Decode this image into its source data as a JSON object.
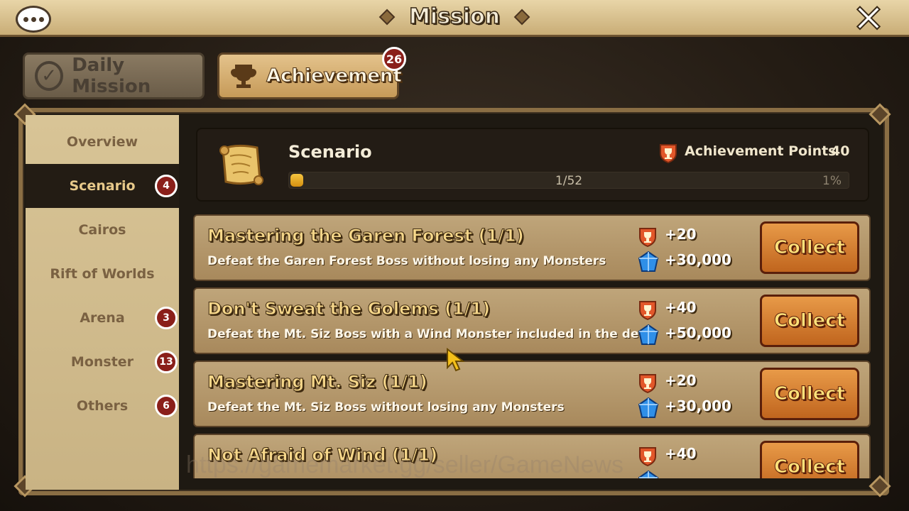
{
  "window": {
    "title": "Mission",
    "chat_icon": "chat-bubble-icon",
    "close_icon": "close-icon"
  },
  "tabs": [
    {
      "label": "Daily Mission",
      "icon": "checkmark-icon",
      "active": false
    },
    {
      "label": "Achievement",
      "icon": "trophy-icon",
      "active": true,
      "badge": "26"
    }
  ],
  "sidebar": {
    "items": [
      {
        "label": "Overview",
        "badge": ""
      },
      {
        "label": "Scenario",
        "badge": "4",
        "active": true
      },
      {
        "label": "Cairos",
        "badge": ""
      },
      {
        "label": "Rift of Worlds",
        "badge": ""
      },
      {
        "label": "Arena",
        "badge": "3"
      },
      {
        "label": "Monster",
        "badge": "13"
      },
      {
        "label": "Others",
        "badge": "6"
      }
    ]
  },
  "header": {
    "icon": "scroll-map-icon",
    "title": "Scenario",
    "points_label": "Achievement Points",
    "points_value": "40",
    "progress_text": "1/52",
    "progress_percent_label": "1%",
    "progress_fraction": 0.02
  },
  "missions": [
    {
      "title": "Mastering the Garen Forest (1/1)",
      "desc": "Defeat the Garen Forest Boss without losing any Monsters",
      "points": "+20",
      "crystals": "+30,000",
      "button": "Collect"
    },
    {
      "title": "Don't Sweat the Golems (1/1)",
      "desc": "Defeat the Mt. Siz Boss with a Wind Monster included in the deck",
      "points": "+40",
      "crystals": "+50,000",
      "button": "Collect"
    },
    {
      "title": "Mastering Mt. Siz (1/1)",
      "desc": "Defeat the Mt. Siz Boss without losing any Monsters",
      "points": "+20",
      "crystals": "+30,000",
      "button": "Collect"
    },
    {
      "title": "Not Afraid of Wind (1/1)",
      "desc": "",
      "points": "+40",
      "crystals": "",
      "button": "Collect"
    }
  ],
  "watermark": "https://gamemarket.gg/seller/GameNews",
  "colors": {
    "badge_red": "#8a1f1a",
    "collect_orange": "#d67a2e",
    "title_gold": "#f6d78a"
  }
}
